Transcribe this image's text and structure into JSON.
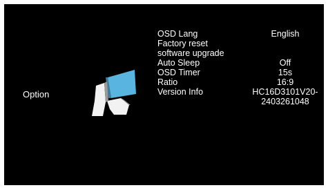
{
  "section": {
    "label": "Option"
  },
  "logo": {
    "icon": "brand-logo-icon",
    "accent_color": "#5ab4e0"
  },
  "menu": {
    "items": [
      {
        "label": "OSD Lang",
        "value": "English"
      },
      {
        "label": "Factory reset",
        "value": ""
      },
      {
        "label": "software upgrade",
        "value": ""
      },
      {
        "label": "Auto Sleep",
        "value": "Off"
      },
      {
        "label": "OSD Timer",
        "value": "15s"
      },
      {
        "label": "Ratio",
        "value": "16:9"
      },
      {
        "label": "Version Info",
        "value": "HC16D3101V20-2403261048"
      }
    ]
  }
}
